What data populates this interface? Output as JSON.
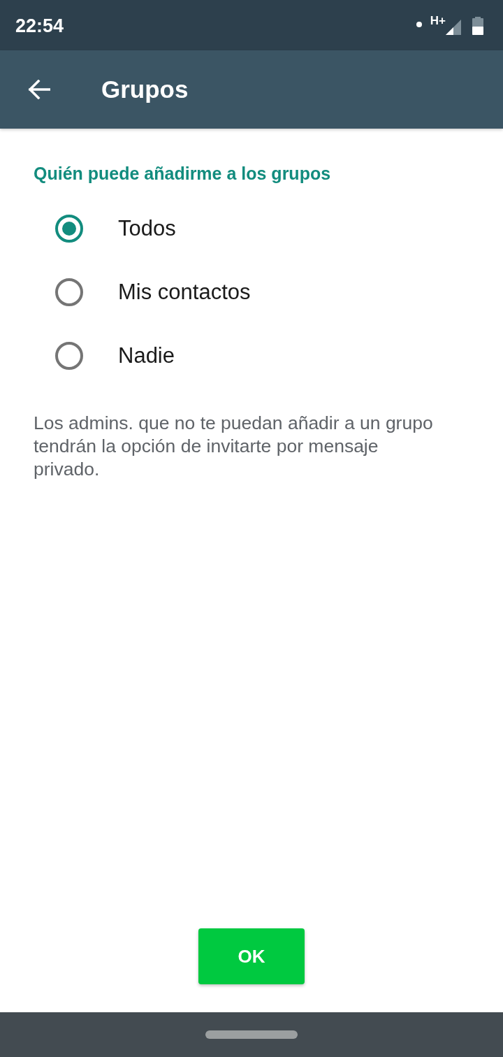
{
  "status_bar": {
    "time": "22:54",
    "network": "H+"
  },
  "app_bar": {
    "title": "Grupos"
  },
  "section": {
    "heading": "Quién puede añadirme a los grupos",
    "options": [
      {
        "label": "Todos",
        "selected": true
      },
      {
        "label": "Mis contactos",
        "selected": false
      },
      {
        "label": "Nadie",
        "selected": false
      }
    ],
    "note": "Los admins. que no te puedan añadir a un grupo tendrán la opción de invitarte por mensaje privado."
  },
  "buttons": [
    {
      "label": "OK"
    }
  ]
}
